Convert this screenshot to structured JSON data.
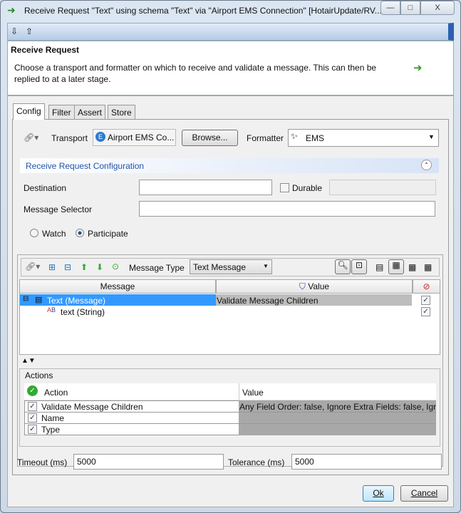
{
  "window": {
    "title": "Receive Request \"Text\" using schema \"Text\" via \"Airport EMS Connection\" [HotairUpdate/RV...",
    "minimize": "—",
    "maximize": "□",
    "close": "X"
  },
  "header": {
    "title": "Receive Request",
    "description": "Choose a transport and formatter on which to receive and validate a message. This can then be replied to at a later stage."
  },
  "tabs": [
    {
      "label": "Config"
    },
    {
      "label": "Filter"
    },
    {
      "label": "Assert"
    },
    {
      "label": "Store"
    }
  ],
  "transport": {
    "label": "Transport",
    "value": "Airport EMS Co...",
    "browse": "Browse...",
    "formatter_label": "Formatter",
    "formatter_value": "EMS"
  },
  "config": {
    "title": "Receive Request Configuration",
    "destination_label": "Destination",
    "destination_value": "",
    "durable_label": "Durable",
    "durable_checked": false,
    "selector_label": "Message Selector",
    "selector_value": "",
    "watch_label": "Watch",
    "participate_label": "Participate",
    "selected_mode": "Participate"
  },
  "message": {
    "type_label": "Message Type",
    "type_value": "Text Message",
    "columns": [
      "Message",
      "Value"
    ],
    "rows": [
      {
        "name": "Text (Message)",
        "value": "Validate Message Children",
        "checked": true,
        "selected": true
      },
      {
        "name": "text (String)",
        "value": "",
        "checked": true
      }
    ]
  },
  "actions": {
    "title": "Actions",
    "columns": [
      "Action",
      "Value"
    ],
    "rows": [
      {
        "action": "Validate Message Children",
        "value": "Any Field Order: false, Ignore Extra Fields: false, Igr",
        "checked": true
      },
      {
        "action": "Name",
        "value": "",
        "checked": true
      },
      {
        "action": "Type",
        "value": "",
        "checked": true
      }
    ]
  },
  "timeout": {
    "label": "Timeout (ms)",
    "value": "5000"
  },
  "tolerance": {
    "label": "Tolerance (ms)",
    "value": "5000"
  },
  "buttons": {
    "ok": "Ok",
    "cancel": "Cancel"
  },
  "colors": {
    "selection": "#3399ff",
    "accent": "#2c5fb0",
    "link": "#2255aa"
  }
}
